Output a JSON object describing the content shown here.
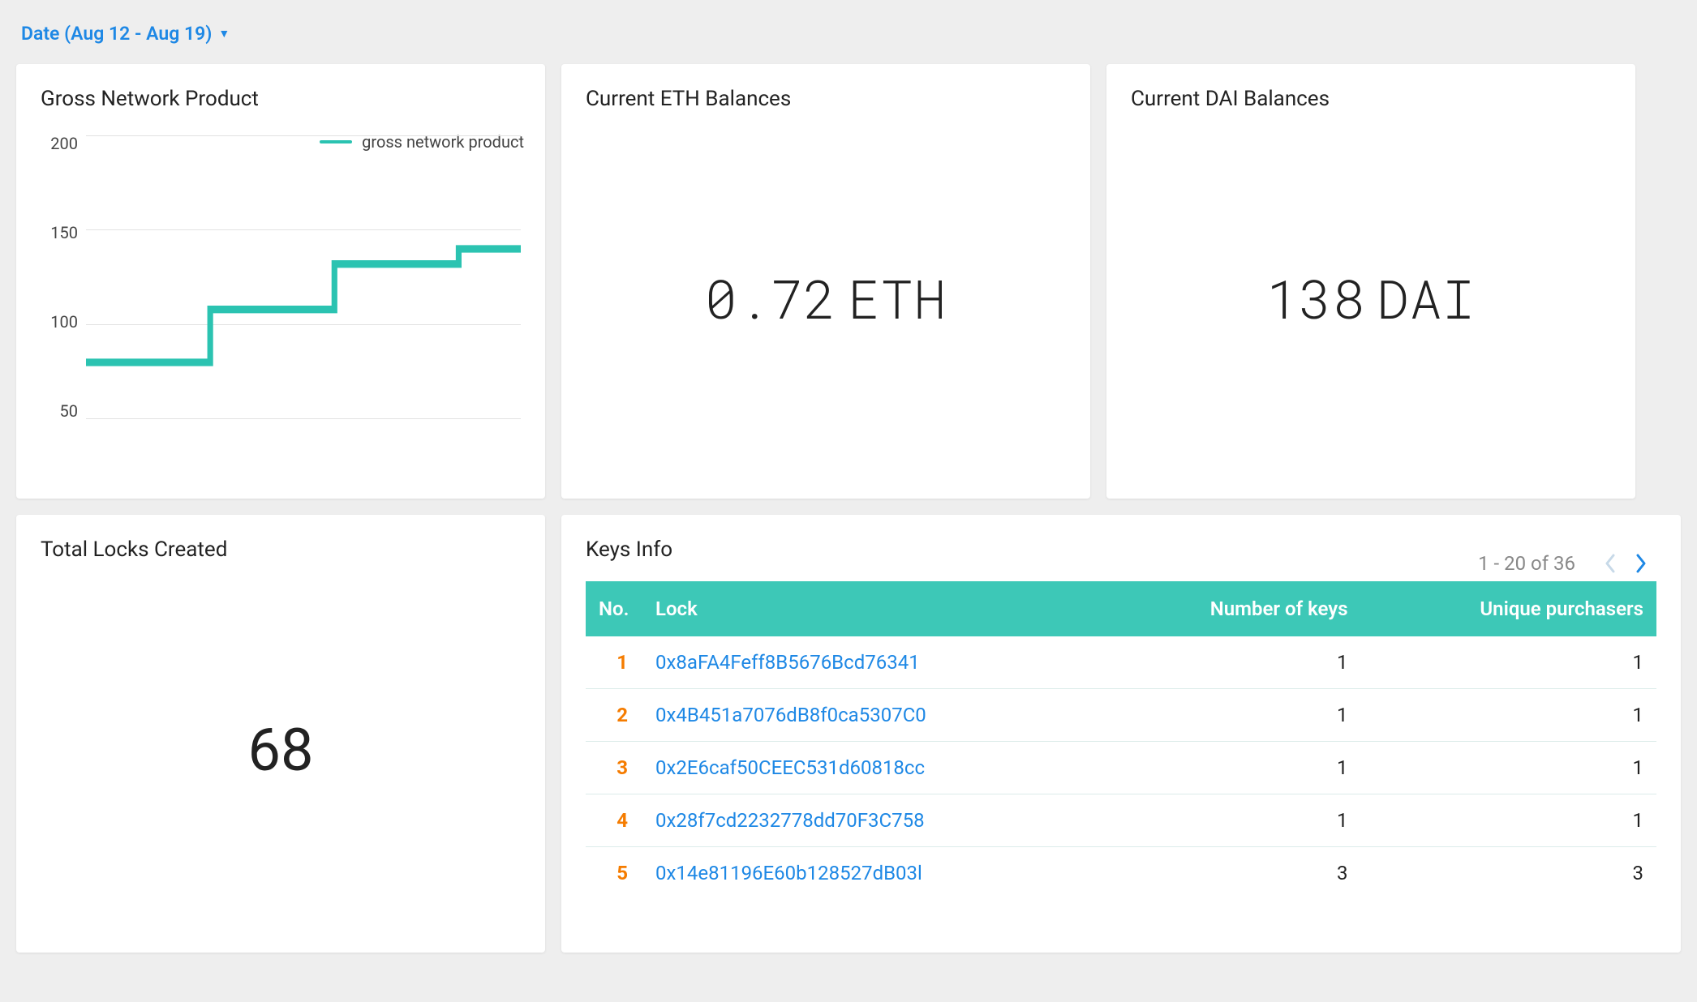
{
  "date_range": {
    "label": "Date (Aug 12 - Aug 19)"
  },
  "cards": {
    "gnp": {
      "title": "Gross Network Product"
    },
    "eth": {
      "title": "Current ETH Balances",
      "value": "0.72",
      "unit": "ETH"
    },
    "dai": {
      "title": "Current DAI Balances",
      "value": "138",
      "unit": "DAI"
    },
    "locks": {
      "title": "Total Locks Created",
      "value": "68"
    },
    "keys": {
      "title": "Keys Info",
      "pager": "1 - 20 of 36",
      "headers": {
        "no": "No.",
        "lock": "Lock",
        "nkeys": "Number of keys",
        "uniq": "Unique purchasers"
      },
      "rows": [
        {
          "no": "1",
          "lock": "0x8aFA4Feff8B5676Bcd76341",
          "nkeys": "1",
          "uniq": "1"
        },
        {
          "no": "2",
          "lock": "0x4B451a7076dB8f0ca5307C0",
          "nkeys": "1",
          "uniq": "1"
        },
        {
          "no": "3",
          "lock": "0x2E6caf50CEEC531d60818cc",
          "nkeys": "1",
          "uniq": "1"
        },
        {
          "no": "4",
          "lock": "0x28f7cd2232778dd70F3C758",
          "nkeys": "1",
          "uniq": "1"
        },
        {
          "no": "5",
          "lock": "0x14e81196E60b128527dB03l",
          "nkeys": "3",
          "uniq": "3"
        }
      ]
    }
  },
  "chart_data": {
    "type": "line",
    "title": "Gross Network Product",
    "xlabel": "",
    "ylabel": "",
    "ylim": [
      50,
      200
    ],
    "yticks": [
      50,
      100,
      150,
      200
    ],
    "legend": "gross network product",
    "series": [
      {
        "name": "gross network product",
        "x": [
          0,
          1,
          2,
          3,
          4,
          5,
          6,
          7
        ],
        "values": [
          80,
          80,
          108,
          108,
          132,
          132,
          140,
          142
        ]
      }
    ]
  }
}
